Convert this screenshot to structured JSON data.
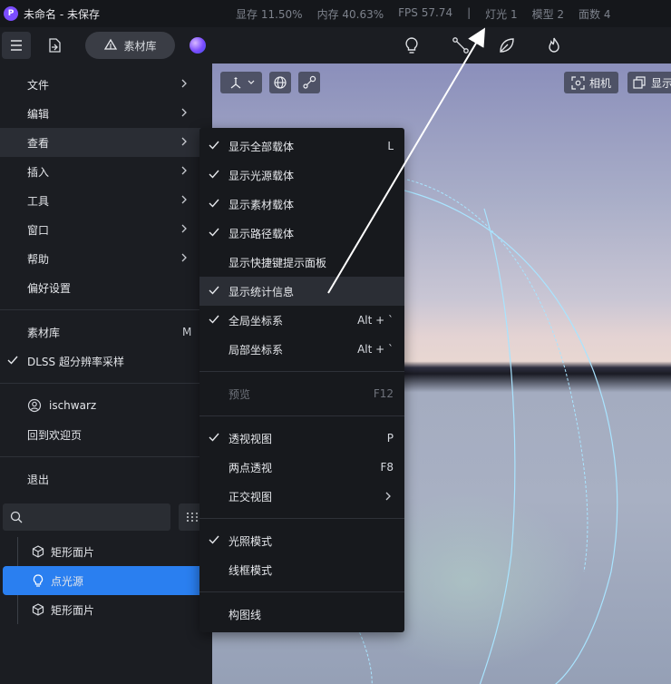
{
  "titlebar": {
    "app_logo": "P",
    "title": "未命名 - 未保存",
    "stats": [
      "显存 11.50%",
      "内存 40.63%",
      "FPS 57.74",
      "|",
      "灯光 1",
      "模型 2",
      "面数 4"
    ]
  },
  "toolbar": {
    "library_label": "素材库",
    "tool_icons": [
      "lightbulb-icon",
      "path-node-icon",
      "leaf-icon",
      "flame-icon"
    ]
  },
  "viewport": {
    "camera_label": "相机",
    "display_label": "显示"
  },
  "menu": {
    "items": [
      {
        "label": "文件",
        "submenu": true
      },
      {
        "label": "编辑",
        "submenu": true
      },
      {
        "label": "查看",
        "submenu": true,
        "active": true
      },
      {
        "label": "插入",
        "submenu": true
      },
      {
        "label": "工具",
        "submenu": true
      },
      {
        "label": "窗口",
        "submenu": true
      },
      {
        "label": "帮助",
        "submenu": true
      },
      {
        "label": "偏好设置"
      }
    ],
    "library": {
      "label": "素材库",
      "shortcut": "M"
    },
    "dlss": {
      "label": "DLSS 超分辨率采样",
      "checked": true
    },
    "user": {
      "label": "ischwarz"
    },
    "welcome": {
      "label": "回到欢迎页"
    },
    "quit": {
      "label": "退出"
    }
  },
  "submenu": {
    "groups": [
      [
        {
          "label": "显示全部载体",
          "checked": true,
          "shortcut": "L"
        },
        {
          "label": "显示光源载体",
          "checked": true
        },
        {
          "label": "显示素材载体",
          "checked": true
        },
        {
          "label": "显示路径载体",
          "checked": true
        },
        {
          "label": "显示快捷键提示面板",
          "checked": false
        },
        {
          "label": "显示统计信息",
          "checked": true,
          "hover": true
        },
        {
          "label": "全局坐标系",
          "checked": true,
          "shortcut": "Alt + `"
        },
        {
          "label": "局部坐标系",
          "checked": false,
          "shortcut": "Alt + `"
        }
      ],
      [
        {
          "label": "预览",
          "disabled": true,
          "shortcut": "F12"
        }
      ],
      [
        {
          "label": "透视视图",
          "checked": true,
          "shortcut": "P"
        },
        {
          "label": "两点透视",
          "checked": false,
          "shortcut": "F8"
        },
        {
          "label": "正交视图",
          "checked": false,
          "submenu": true
        }
      ],
      [
        {
          "label": "光照模式",
          "checked": true
        },
        {
          "label": "线框模式",
          "checked": false
        }
      ],
      [
        {
          "label": "构图线",
          "checked": false
        }
      ]
    ]
  },
  "search": {
    "placeholder": ""
  },
  "tree": {
    "items": [
      {
        "label": "矩形面片",
        "icon": "cube-icon"
      },
      {
        "label": "点光源",
        "icon": "lightbulb-icon",
        "selected": true
      },
      {
        "label": "矩形面片",
        "icon": "cube-icon"
      }
    ]
  },
  "colors": {
    "accent": "#2a7ff0",
    "background": "#1b1d22",
    "menu_bg": "#17191d",
    "logo": "#7b4dff"
  }
}
